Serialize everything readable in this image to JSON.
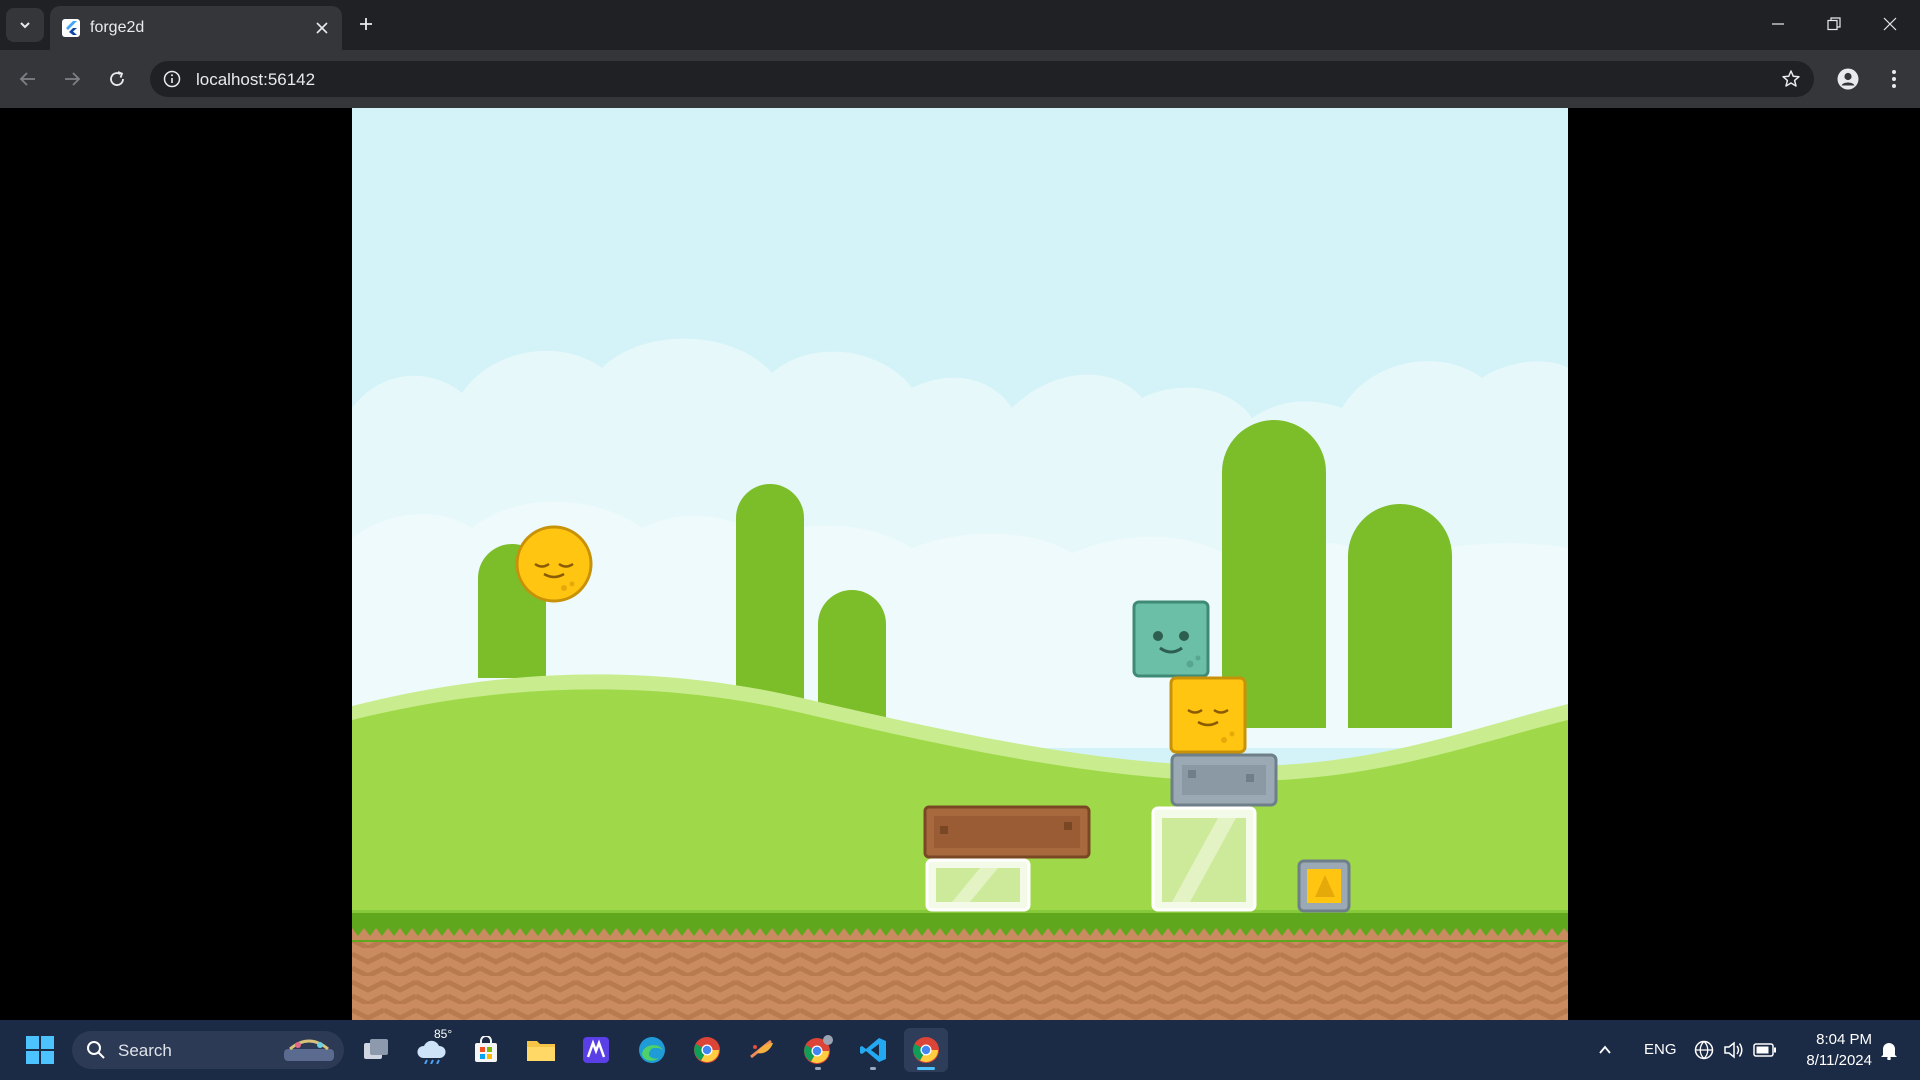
{
  "browser": {
    "tab": {
      "title": "forge2d"
    },
    "address_bar": {
      "url": "localhost:56142"
    }
  },
  "taskbar": {
    "search_label": "Search",
    "weather_temp": "85°",
    "tray": {
      "language": "ENG",
      "time": "8:04 PM",
      "date": "8/11/2024"
    },
    "pinned_apps": [
      "task-view",
      "weather",
      "microsoft-store",
      "file-explorer",
      "app-m",
      "edge",
      "chrome",
      "app-feather",
      "chrome-profile",
      "vscode",
      "chrome-active"
    ]
  },
  "game": {
    "colors": {
      "sky": "#d3f3f8",
      "clouds": "#e6f8fa",
      "hills": "#9fd94a",
      "trees": "#7cbd2a",
      "grass": "#5fa81e",
      "dirt": "#c98b5f",
      "yellow_block": "#ffc511",
      "teal_block": "#6bbfa6",
      "stone_block": "#9aa9b3",
      "wood_block": "#a8693f",
      "glass_block": "#cde99a"
    },
    "objects": [
      "yellow-ball",
      "teal-block",
      "yellow-block",
      "stone-block",
      "wood-plank",
      "glass-block-small",
      "glass-block-large",
      "metal-block-small"
    ]
  }
}
